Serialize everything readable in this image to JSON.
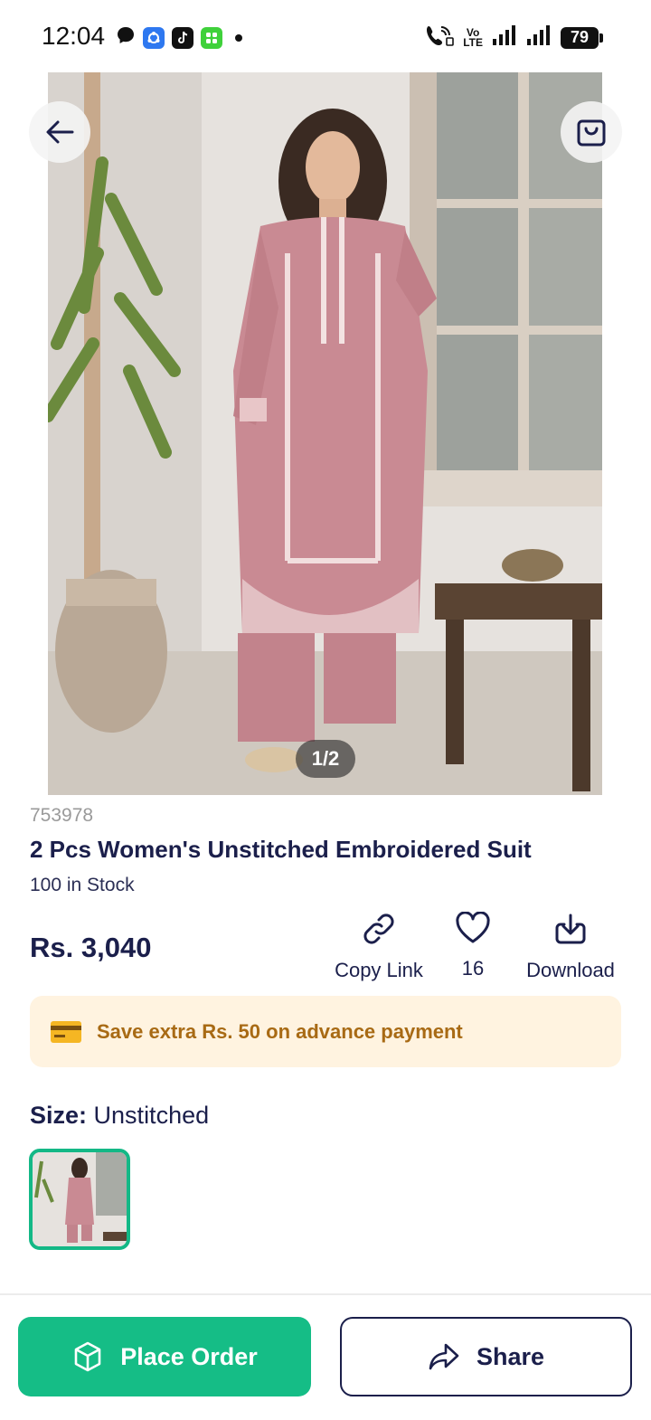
{
  "status_bar": {
    "time": "12:04",
    "volte_top": "Vo",
    "volte_bottom": "LTE",
    "battery": "79"
  },
  "gallery": {
    "pager": "1/2"
  },
  "product": {
    "sku": "753978",
    "title": "2 Pcs Women's Unstitched Embroidered Suit",
    "stock": "100 in Stock",
    "price": "Rs. 3,040"
  },
  "actions": {
    "copy_link": "Copy Link",
    "likes": "16",
    "download": "Download"
  },
  "promo": {
    "text": "Save extra Rs. 50 on advance payment"
  },
  "size": {
    "label": "Size:",
    "value": "Unstitched"
  },
  "buttons": {
    "place_order": "Place Order",
    "share": "Share"
  },
  "colors": {
    "primary_green": "#15bd86",
    "navy": "#1b1f4b",
    "promo_bg": "#fff3e0",
    "promo_text": "#a86a14",
    "outfit_pink": "#c98a93"
  }
}
